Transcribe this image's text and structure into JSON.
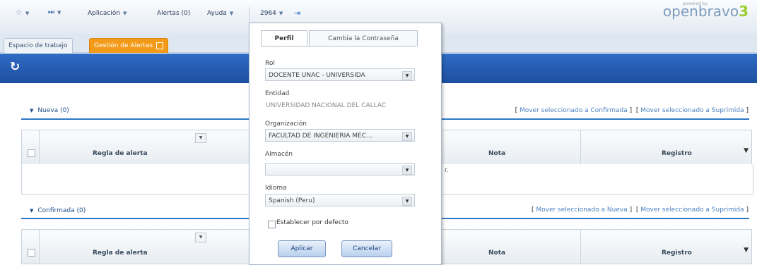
{
  "topbar": {
    "menu": [
      {
        "label": "Aplicación"
      },
      {
        "label": "Alertas (0)"
      },
      {
        "label": "Ayuda"
      }
    ],
    "user_label": "2964",
    "logo_small": "powered by",
    "logo_text": "openbravo",
    "logo_version": "3"
  },
  "tabs": {
    "workspace": "Espacio de trabajo",
    "alerts": "Gestión de Alertas"
  },
  "sections": [
    {
      "title": "Nueva (0)",
      "actions": [
        "Mover seleccionado a Confirmada",
        "Mover seleccionado a Suprimida"
      ],
      "columns": {
        "rule": "Regla de alerta",
        "note": "Nota",
        "record": "Registro"
      },
      "empty_fragment": "r."
    },
    {
      "title": "Confirmada (0)",
      "actions": [
        "Mover seleccionado a Nueva",
        "Mover seleccionado a Suprimida"
      ],
      "columns": {
        "rule": "Regla de alerta",
        "note": "Nota",
        "record": "Registro"
      }
    }
  ],
  "profile_popup": {
    "tab_profile": "Perfil",
    "tab_password": "Cambia la Contraseña",
    "role_label": "Rol",
    "role_value": "DOCENTE UNAC - UNIVERSIDA",
    "entity_label": "Entidad",
    "entity_value": "UNIVERSIDAD NACIONAL DEL CALLAC",
    "org_label": "Organización",
    "org_value": "FACULTAD DE INGENIERIA MEC...",
    "warehouse_label": "Almacén",
    "warehouse_value": "",
    "language_label": "Idioma",
    "language_value": "Spanish (Peru)",
    "default_label": "Establecer por defecto",
    "apply_label": "Aplicar",
    "cancel_label": "Cancelar"
  }
}
